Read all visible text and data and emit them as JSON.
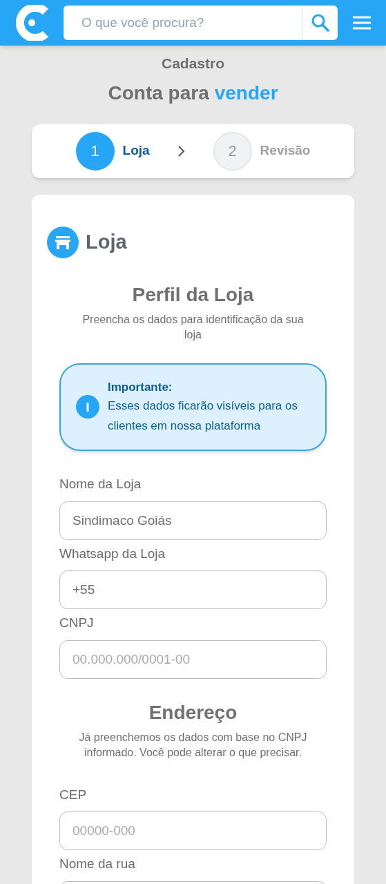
{
  "header": {
    "search": {
      "placeholder": "O que você procura?"
    }
  },
  "page": {
    "overline": "Cadastro",
    "title": "Conta para",
    "title_highlight": "vender"
  },
  "steps": [
    {
      "number": "1",
      "label": "Loja",
      "selected": true
    },
    {
      "number": "2",
      "label": "Revisão",
      "selected": false
    }
  ],
  "section": {
    "title": "Loja"
  },
  "groups": [
    {
      "title": "Perfil da Loja",
      "subtitle": "Preencha os dados para identificação da sua loja",
      "notice": {
        "title": "Importante:",
        "text": "Esses dados ficarão visíveis para os clientes em nossa plataforma"
      },
      "fields": [
        {
          "label": "Nome da Loja",
          "value": "Sindimaco Goiás"
        },
        {
          "label": "Whatsapp da Loja",
          "value": "+55"
        },
        {
          "label": "CNPJ",
          "placeholder": "00.000.000/0001-00"
        }
      ]
    },
    {
      "title": "Endereço",
      "subtitle": "Já preenchemos os dados com base no CNPJ informado. Você pode alterar o que precisar.",
      "fields": [
        {
          "label": "CEP",
          "placeholder": "00000-000"
        },
        {
          "label": "Nome da rua"
        }
      ]
    }
  ]
}
